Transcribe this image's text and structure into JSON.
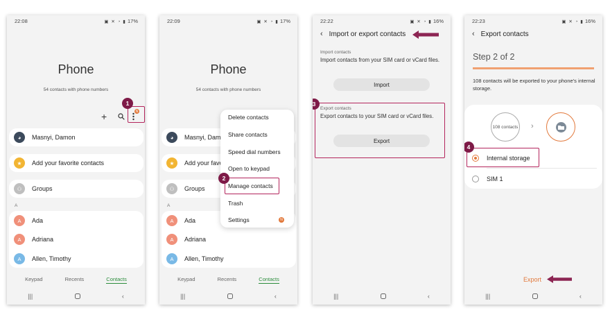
{
  "status": {
    "s1": {
      "time": "22:08",
      "right": "17%"
    },
    "s2": {
      "time": "22:09",
      "right": "17%"
    },
    "s3": {
      "time": "22:22",
      "right": "16%"
    },
    "s4": {
      "time": "22:23",
      "right": "16%"
    }
  },
  "phone_title": "Phone",
  "contacts_count": "54 contacts with phone numbers",
  "contacts": {
    "my_profile": "Masnyi, Damon",
    "favorites": "Add your favorite contacts",
    "groups": "Groups",
    "index_letter": "A",
    "list": [
      {
        "initial": "A",
        "name": "Ada"
      },
      {
        "initial": "A",
        "name": "Adriana"
      },
      {
        "initial": "A",
        "name": "Allen, Timothy"
      }
    ]
  },
  "tabs": {
    "keypad": "Keypad",
    "recents": "Recents",
    "contacts": "Contacts"
  },
  "menu": {
    "delete": "Delete contacts",
    "share": "Share contacts",
    "speed_dial": "Speed dial numbers",
    "open_keypad": "Open to keypad",
    "manage": "Manage contacts",
    "trash": "Trash",
    "settings": "Settings",
    "settings_badge": "N"
  },
  "more_badge": "N",
  "import_export": {
    "title": "Import or export contacts",
    "import_label": "Import contacts",
    "import_text": "Import contacts from your SIM card or vCard files.",
    "import_button": "Import",
    "export_label": "Export contacts",
    "export_text": "Export contacts to your SIM card or vCard files.",
    "export_button": "Export"
  },
  "export": {
    "title": "Export contacts",
    "step": "Step 2 of 2",
    "progress": 1.0,
    "description": "108 contacts will be exported to your phone's internal storage.",
    "source_circle": "108 contacts",
    "option_internal": "Internal storage",
    "option_sim": "SIM 1",
    "export_button": "Export"
  },
  "steps": [
    "1",
    "2",
    "3",
    "4"
  ],
  "colors": {
    "accent_orange": "#e2793c",
    "step_maroon": "#7e1a47",
    "highlight": "#b3245c",
    "tab_green": "#2a8c3b"
  }
}
